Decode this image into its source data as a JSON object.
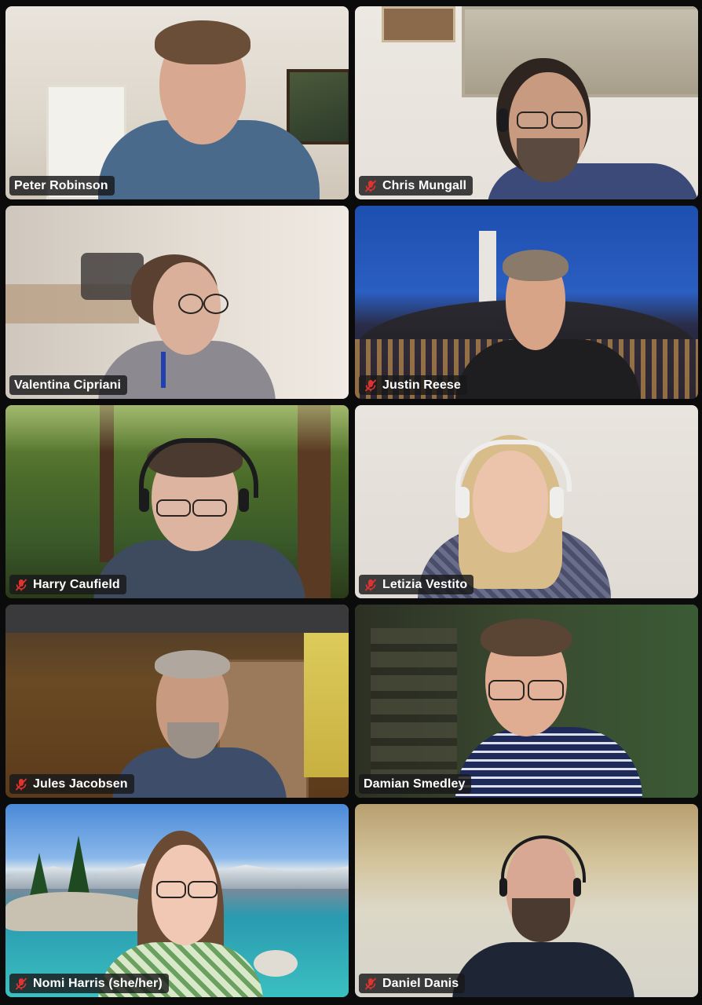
{
  "meeting": {
    "participants": [
      {
        "name": "Peter Robinson",
        "muted": false,
        "active_speaker": false
      },
      {
        "name": "Chris Mungall",
        "muted": true,
        "active_speaker": false
      },
      {
        "name": "Valentina Cipriani",
        "muted": false,
        "active_speaker": false
      },
      {
        "name": "Justin Reese",
        "muted": true,
        "active_speaker": false
      },
      {
        "name": "Harry Caufield",
        "muted": true,
        "active_speaker": false
      },
      {
        "name": "Letizia Vestito",
        "muted": true,
        "active_speaker": false
      },
      {
        "name": "Jules Jacobsen",
        "muted": true,
        "active_speaker": false
      },
      {
        "name": "Damian Smedley",
        "muted": false,
        "active_speaker": true
      },
      {
        "name": "Nomi Harris (she/her)",
        "muted": true,
        "active_speaker": false
      },
      {
        "name": "Daniel Danis",
        "muted": true,
        "active_speaker": false
      }
    ]
  },
  "colors": {
    "background": "#0b0b0c",
    "active_speaker_border": "#37d14a",
    "muted_icon": "#e0322f",
    "name_tag_bg": "#18181a",
    "name_text": "#ffffff"
  },
  "icons": {
    "muted": "microphone-muted-icon"
  }
}
